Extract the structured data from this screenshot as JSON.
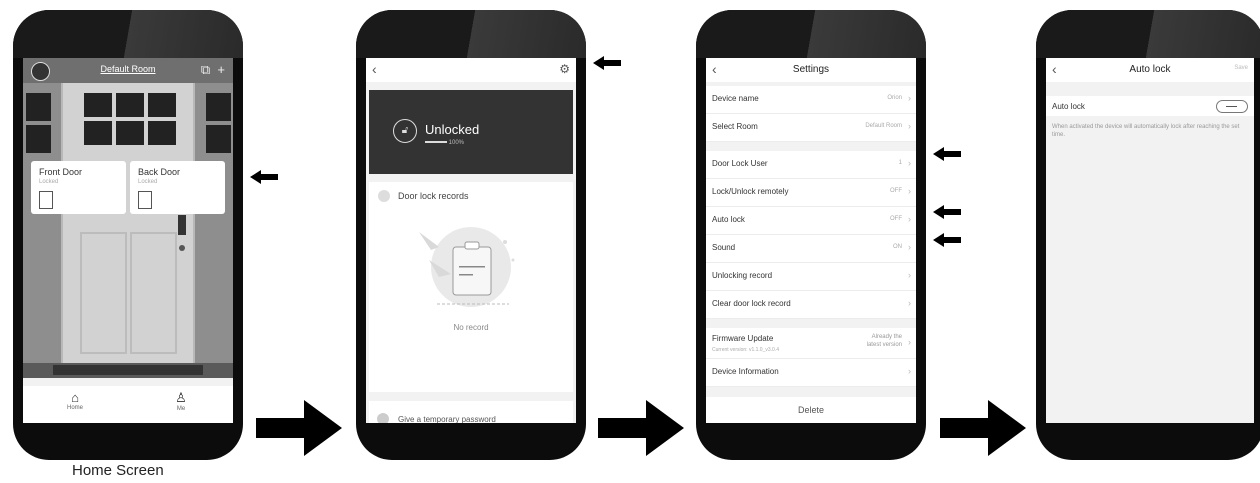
{
  "caption": "Home Screen",
  "home": {
    "room_title": "Default Room",
    "devices": [
      {
        "name": "Front Door",
        "status": "Locked"
      },
      {
        "name": "Back Door",
        "status": "Locked"
      }
    ],
    "tabs": [
      {
        "icon": "home-icon",
        "label": "Home"
      },
      {
        "icon": "person-icon",
        "label": "Me"
      }
    ]
  },
  "device": {
    "lock_state": "Unlocked",
    "battery": "100%",
    "records_label": "Door lock records",
    "empty_label": "No record",
    "bottom_partial": "Give a temporary password"
  },
  "settings": {
    "title": "Settings",
    "rows": [
      {
        "label": "Device name",
        "value": "Orion"
      },
      {
        "label": "Select Room",
        "value": "Default Room"
      },
      {
        "label": "Door Lock User",
        "value": "1"
      },
      {
        "label": "Lock/Unlock remotely",
        "value": "OFF"
      },
      {
        "label": "Auto lock",
        "value": "OFF"
      },
      {
        "label": "Sound",
        "value": "ON"
      },
      {
        "label": "Unlocking record",
        "value": ""
      },
      {
        "label": "Clear door lock record",
        "value": ""
      },
      {
        "label": "Firmware Update",
        "sub": "Current version: v1.1.0_v3.0.4",
        "value1": "Already the",
        "value2": "latest version"
      },
      {
        "label": "Device Information",
        "value": ""
      }
    ],
    "delete_label": "Delete"
  },
  "autolock": {
    "title": "Auto lock",
    "save_label": "Save",
    "row_label": "Auto lock",
    "description": "When activated the device will automatically lock after reaching the set time."
  },
  "colors": {
    "frame": "#0c0c0c",
    "screen": "#f2f2f2",
    "dark_panel": "#333333"
  }
}
